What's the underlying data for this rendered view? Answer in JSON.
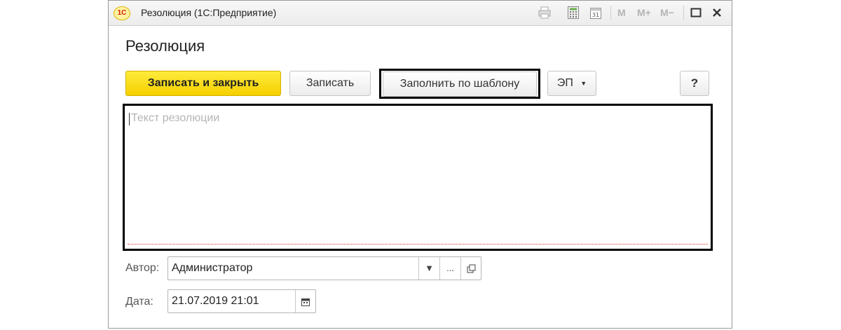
{
  "window": {
    "title": "Резолюция  (1С:Предприятие)",
    "logo_text": "1С",
    "memory_buttons": [
      "M",
      "M+",
      "M−"
    ]
  },
  "form": {
    "title": "Резолюция",
    "buttons": {
      "save_close": "Записать и закрыть",
      "save": "Записать",
      "fill_template": "Заполнить по шаблону",
      "ep": "ЭП",
      "help": "?"
    },
    "resolution_text": {
      "value": "",
      "placeholder": "Текст резолюции"
    },
    "author": {
      "label": "Автор:",
      "value": "Администратор"
    },
    "date": {
      "label": "Дата:",
      "value": "21.07.2019 21:01"
    }
  },
  "icons": {
    "print": "print-icon",
    "calculator": "calculator-icon",
    "calendar": "calendar-icon",
    "maximize": "maximize-icon",
    "close": "close-icon",
    "dropdown": "chevron-down-icon",
    "open": "open-icon"
  }
}
